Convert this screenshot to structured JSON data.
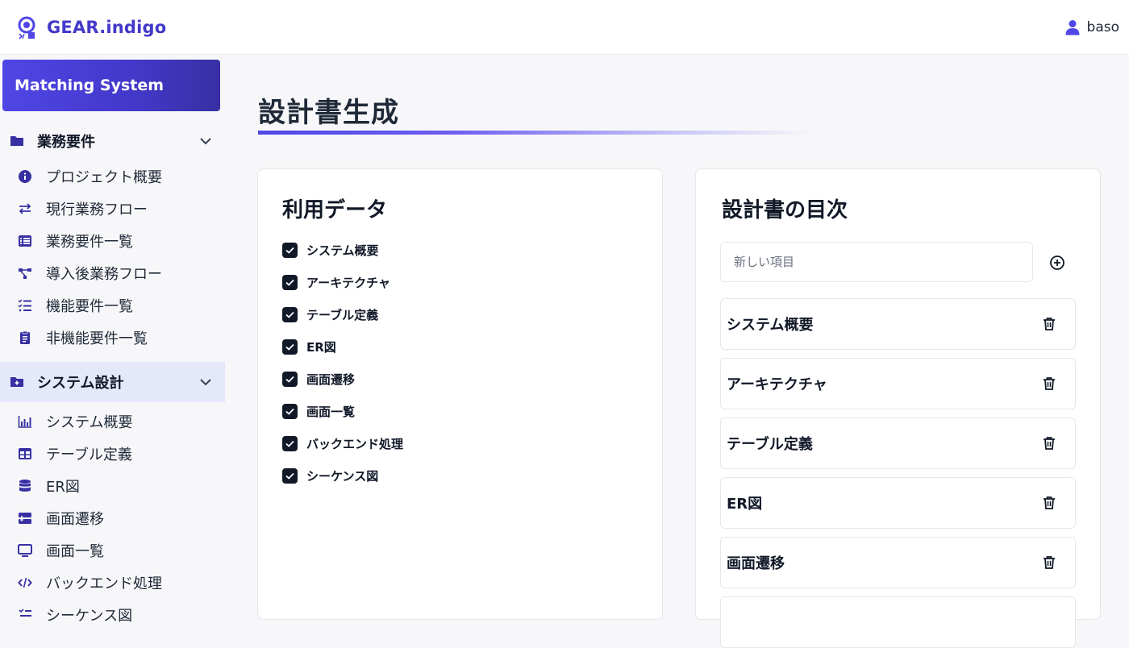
{
  "header": {
    "brand": "GEAR.indigo",
    "user": "baso"
  },
  "sidebar": {
    "project": "Matching System",
    "sections": [
      {
        "label": "業務要件",
        "items": [
          {
            "label": "プロジェクト概要",
            "icon": "info-icon"
          },
          {
            "label": "現行業務フロー",
            "icon": "arrows-exchange-icon"
          },
          {
            "label": "業務要件一覧",
            "icon": "list-table-icon"
          },
          {
            "label": "導入後業務フロー",
            "icon": "flow-diagram-icon"
          },
          {
            "label": "機能要件一覧",
            "icon": "checklist-icon"
          },
          {
            "label": "非機能要件一覧",
            "icon": "clipboard-icon"
          }
        ]
      },
      {
        "label": "システム設計",
        "items": [
          {
            "label": "システム概要",
            "icon": "bar-chart-icon"
          },
          {
            "label": "テーブル定義",
            "icon": "table-icon"
          },
          {
            "label": "ER図",
            "icon": "database-icon"
          },
          {
            "label": "画面遷移",
            "icon": "transition-icon"
          },
          {
            "label": "画面一覧",
            "icon": "monitor-icon"
          },
          {
            "label": "バックエンド処理",
            "icon": "code-icon"
          },
          {
            "label": "シーケンス図",
            "icon": "sequence-icon"
          }
        ]
      }
    ]
  },
  "main": {
    "title": "設計書生成",
    "data_card": {
      "title": "利用データ",
      "items": [
        "システム概要",
        "アーキテクチャ",
        "テーブル定義",
        "ER図",
        "画面遷移",
        "画面一覧",
        "バックエンド処理",
        "シーケンス図"
      ]
    },
    "toc_card": {
      "title": "設計書の目次",
      "placeholder": "新しい項目",
      "items": [
        "システム概要",
        "アーキテクチャ",
        "テーブル定義",
        "ER図",
        "画面遷移"
      ]
    }
  },
  "colors": {
    "accent": "#4f46e5",
    "active_bg": "#e5e8fb",
    "text": "#1f2937"
  }
}
